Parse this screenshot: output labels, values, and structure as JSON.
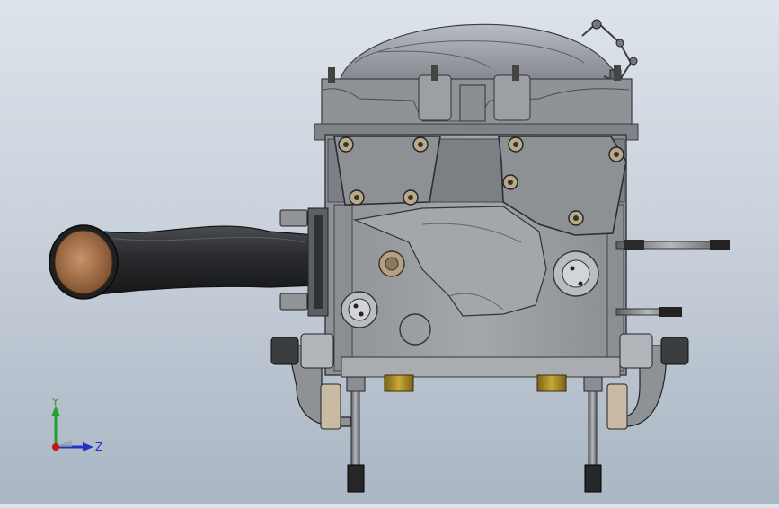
{
  "viewport": {
    "background_top": "#dde3ea",
    "background_bottom": "#aab6c4"
  },
  "triad": {
    "y_label": "Y",
    "z_label": "Z",
    "y_color": "#22a02a",
    "z_color": "#2232c8",
    "origin_color": "#cc1111"
  },
  "model": {
    "body_color": "#9b9ea2",
    "cover_color": "#a6a9ad",
    "hose_color": "#2a2c2e",
    "copper_color": "#b27a4c",
    "brass_color": "#b89a2a"
  }
}
